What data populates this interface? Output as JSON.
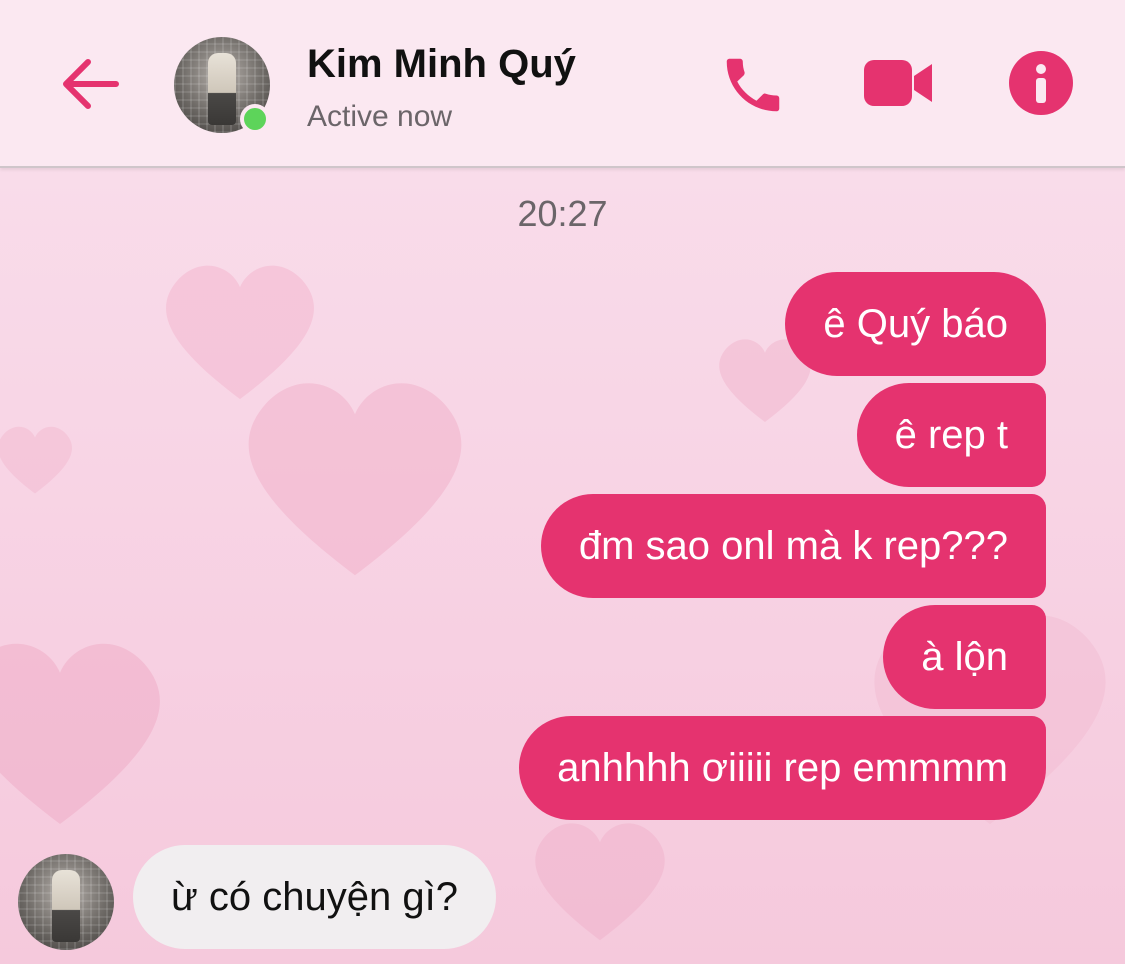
{
  "header": {
    "contact_name": "Kim Minh Quý",
    "status": "Active now",
    "back_icon": "back-arrow-icon",
    "actions": [
      "phone-icon",
      "video-call-icon",
      "info-icon"
    ],
    "accent_color": "#e5336f",
    "online_color": "#5dd45a"
  },
  "conversation": {
    "timestamp": "20:27",
    "sent_messages": [
      "ê Quý báo",
      "ê rep t",
      "đm sao onl mà k rep???",
      "à lộn",
      "anhhhh ơiiiii rep emmmm"
    ],
    "received_messages": [
      "ừ có chuyện gì?"
    ],
    "sent_bubble_color": "#e5336f",
    "received_bubble_color": "#f1eef0"
  }
}
